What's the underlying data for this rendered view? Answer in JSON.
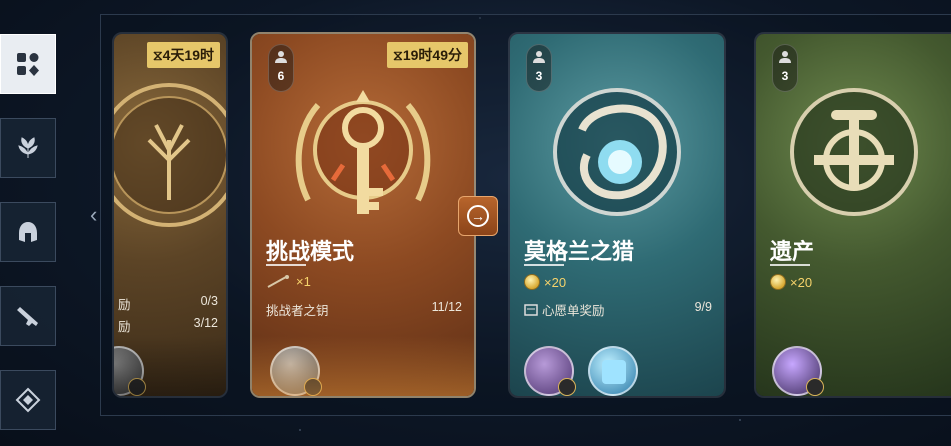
{
  "nav": [
    {
      "name": "grid-icon",
      "active": true
    },
    {
      "name": "plant-icon",
      "active": false
    },
    {
      "name": "helmet-icon",
      "active": false
    },
    {
      "name": "rifle-icon",
      "active": false
    },
    {
      "name": "diamond-icon",
      "active": false
    }
  ],
  "cards": [
    {
      "timer": "⧖4天19时",
      "tasks": [
        {
          "label": "励",
          "value": "0/3"
        },
        {
          "label": "励",
          "value": "3/12"
        }
      ]
    },
    {
      "players": "6",
      "timer": "⧖19时49分",
      "title": "挑战模式",
      "cost": "×1",
      "task_label": "挑战者之钥",
      "task_value": "11/12"
    },
    {
      "players": "3",
      "title": "莫格兰之猎",
      "cost": "×20",
      "task_label": "心愿单奖励",
      "task_value": "9/9"
    },
    {
      "players": "3",
      "title": "遗产",
      "cost": "×20"
    }
  ],
  "colors": {
    "timer_bg": "#e6c76a",
    "challenge_card": "#8d4a22",
    "morgran_card": "#2f6b74",
    "legacy_card": "#44592f"
  }
}
